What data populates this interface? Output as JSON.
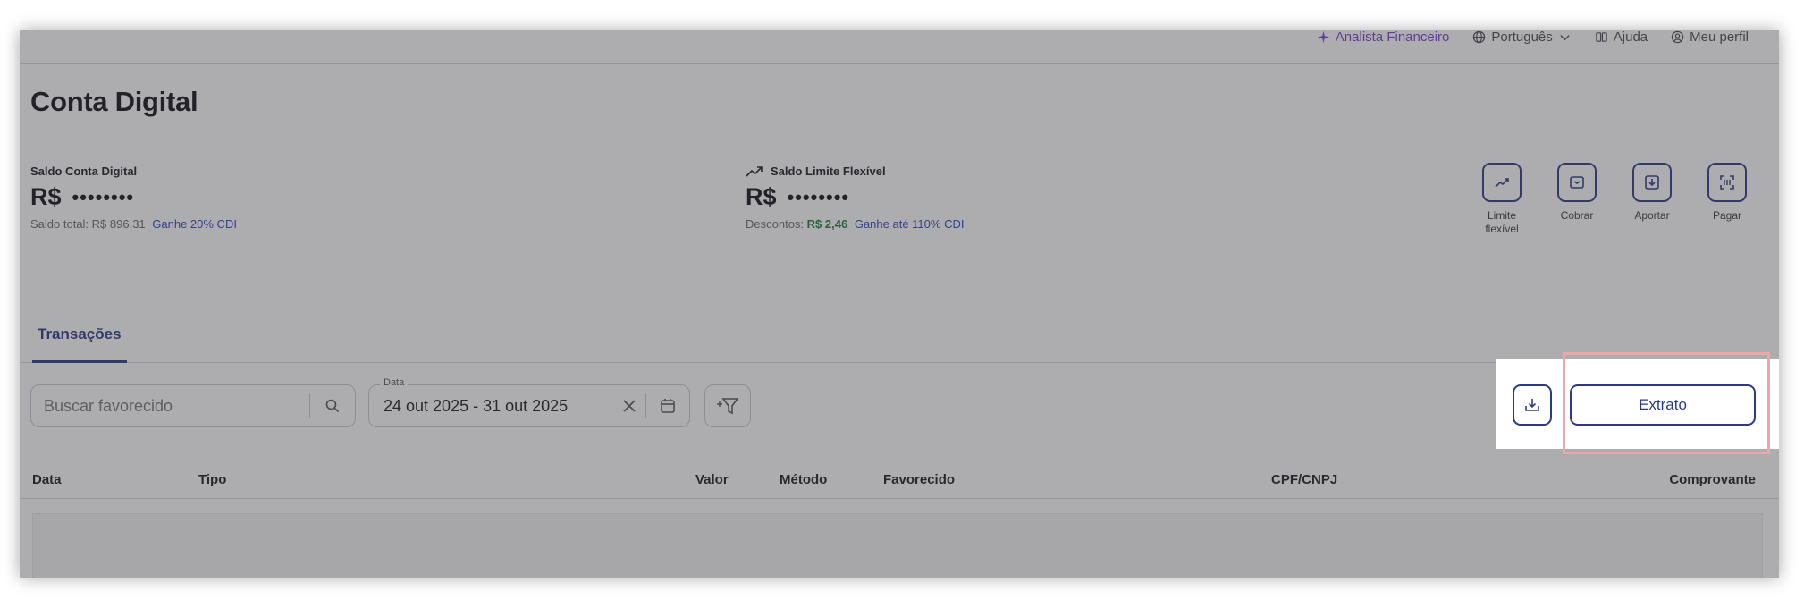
{
  "topbar": {
    "assistant_label": "Analista Financeiro",
    "language_label": "Português",
    "help_label": "Ajuda",
    "profile_label": "Meu perfil"
  },
  "page_title": "Conta Digital",
  "balance_account": {
    "label": "Saldo Conta Digital",
    "currency": "R$",
    "masked_value": "••••••••",
    "subtext": "Saldo total: R$ 896,31",
    "link": "Ganhe 20% CDI"
  },
  "balance_flexible": {
    "label": "Saldo Limite Flexível",
    "currency": "R$",
    "masked_value": "••••••••",
    "subtext_label": "Descontos:",
    "subtext_amount": "R$ 2,46",
    "link": "Ganhe até 110% CDI"
  },
  "quick_actions": [
    {
      "label": "Limite flexível",
      "icon": "trend-up-icon"
    },
    {
      "label": "Cobrar",
      "icon": "inbox-icon"
    },
    {
      "label": "Aportar",
      "icon": "deposit-icon"
    },
    {
      "label": "Pagar",
      "icon": "barcode-scan-icon"
    }
  ],
  "tabs": [
    {
      "label": "Transações",
      "active": true
    }
  ],
  "filters": {
    "search_placeholder": "Buscar favorecido",
    "date_legend": "Data",
    "date_value": "24 out 2025  -  31 out 2025"
  },
  "toolbar": {
    "extrato_label": "Extrato"
  },
  "table": {
    "columns": [
      "Data",
      "Tipo",
      "Valor",
      "Método",
      "Favorecido",
      "CPF/CNPJ",
      "Comprovante"
    ]
  },
  "colors": {
    "accent": "#2b3a8a",
    "link": "#2a46c9",
    "assistant": "#7b3fd8",
    "positive": "#1e7a3a",
    "highlight": "#f0a6a6"
  }
}
